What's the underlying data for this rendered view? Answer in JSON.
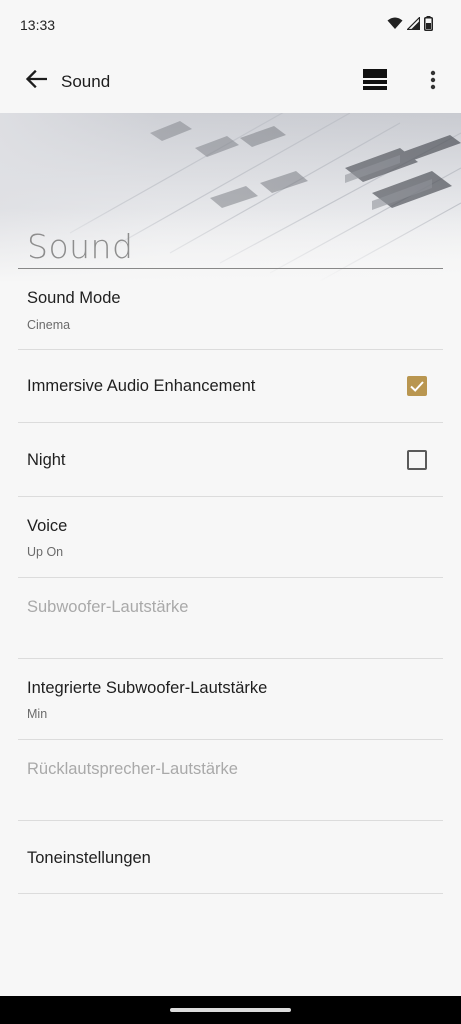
{
  "status_bar": {
    "time": "13:33",
    "icons": [
      "wifi-icon",
      "signal-icon",
      "battery-icon"
    ]
  },
  "app_bar": {
    "title": "Sound",
    "back_icon": "arrow-left-icon",
    "layout_icon": "layout-icon",
    "more_icon": "more-vert-icon"
  },
  "banner": {
    "title": "Sound"
  },
  "settings": [
    {
      "title": "Sound Mode",
      "subtitle": "Cinema",
      "enabled": true
    },
    {
      "title": "Immersive Audio Enhancement",
      "checkbox": true,
      "enabled": true
    },
    {
      "title": "Night",
      "checkbox": false,
      "enabled": true
    },
    {
      "title": "Voice",
      "subtitle": "Up On",
      "enabled": true
    },
    {
      "title": "Subwoofer-Lautstärke",
      "enabled": false
    },
    {
      "title": "Integrierte Subwoofer-Lautstärke",
      "subtitle": "Min",
      "enabled": true
    },
    {
      "title": "Rücklautsprecher-Lautstärke",
      "enabled": false
    },
    {
      "title": "Toneinstellungen",
      "enabled": true
    }
  ],
  "colors": {
    "accent": "#b99650",
    "background": "#f7f7f7",
    "disabled_text": "#a9a9a9"
  }
}
